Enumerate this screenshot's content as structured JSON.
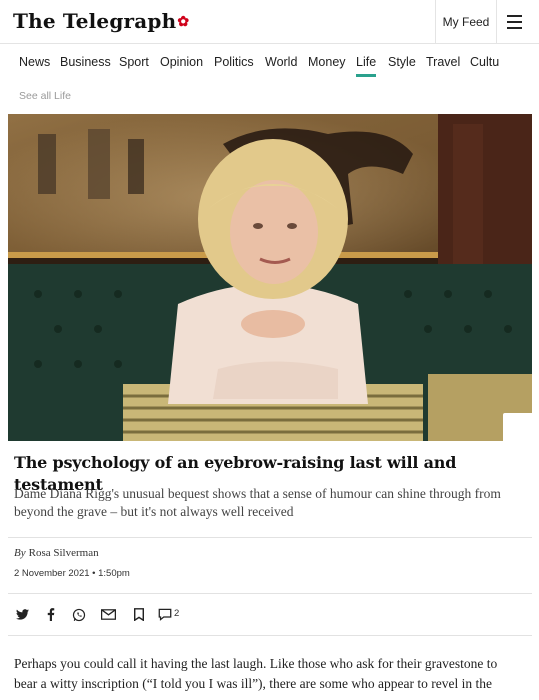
{
  "header": {
    "logo": "The Telegraph",
    "my_feed": "My Feed"
  },
  "nav": {
    "items": [
      {
        "label": "News"
      },
      {
        "label": "Business"
      },
      {
        "label": "Sport"
      },
      {
        "label": "Opinion"
      },
      {
        "label": "Politics"
      },
      {
        "label": "World"
      },
      {
        "label": "Money"
      },
      {
        "label": "Life",
        "active": true
      },
      {
        "label": "Style"
      },
      {
        "label": "Travel"
      },
      {
        "label": "Cultu"
      }
    ],
    "see_all": "See all Life"
  },
  "colors": {
    "accent": "#2aa18d",
    "poppy": "#d0021b"
  },
  "article": {
    "headline": "The psychology of an eyebrow-raising last will and testament",
    "standfirst": "Dame Diana Rigg's unusual bequest shows that a sense of humour can shine through from beyond the grave – but it's not always well received",
    "byline_prefix": "By",
    "author": "Rosa Silverman",
    "date": "2 November 2021 • 1:50pm",
    "comment_count": "2",
    "body_line1": "Perhaps you could call it having the last laugh. Like those who ask for their gravestone to",
    "body_line2": "bear a witty inscription (“I told you I was ill”), there are some who appear to revel in the"
  },
  "share_icons": [
    "twitter-icon",
    "facebook-icon",
    "whatsapp-icon",
    "email-icon",
    "bookmark-icon",
    "comment-icon"
  ]
}
